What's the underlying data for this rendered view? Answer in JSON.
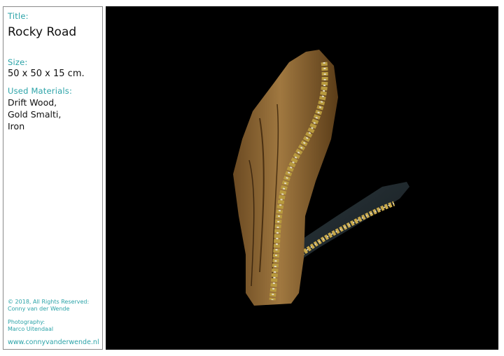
{
  "sidebar": {
    "title_label": "Title:",
    "title_value": "Rocky Road",
    "size_label": "Size:",
    "size_value": "50 x 50 x 15 cm.",
    "materials_label": "Used Materials:",
    "materials": [
      "Drift Wood,",
      "Gold Smalti,",
      "Iron"
    ],
    "copyright_line1": "© 2018, All Rights Reserved:",
    "copyright_line2": "Conny van der Wende",
    "photography_label": "Photography:",
    "photographer": "Marco Uitendaal",
    "website": "www.connyvanderwende.nl"
  },
  "colors": {
    "accent": "#2ba3a8",
    "photo_background": "#000000"
  }
}
